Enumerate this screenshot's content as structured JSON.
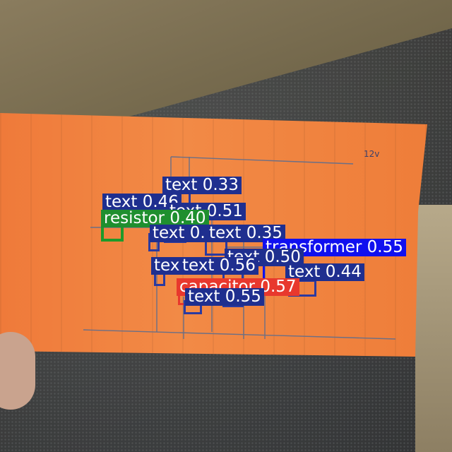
{
  "detections": [
    {
      "label": "text 0.33",
      "cls": "text"
    },
    {
      "label": "text 0.51",
      "cls": "text"
    },
    {
      "label": "text 0.46",
      "cls": "text"
    },
    {
      "label": "resistor 0.40",
      "cls": "resistor"
    },
    {
      "label": "text 0.35",
      "cls": "text"
    },
    {
      "label": "text 0.56",
      "cls": "text"
    },
    {
      "label": "text 0.56",
      "cls": "text"
    },
    {
      "label": "text 0.50",
      "cls": "text"
    },
    {
      "label": "transformer 0.55",
      "cls": "transformer"
    },
    {
      "label": "text 0.44",
      "cls": "text"
    },
    {
      "label": "capacitor 0.57",
      "cls": "capacitor"
    },
    {
      "label": "text 0.55",
      "cls": "text"
    }
  ],
  "colors": {
    "text": "#1f2f8f",
    "resistor": "#1f8f2f",
    "capacitor": "#e8382d",
    "transformer": "#1010ef",
    "paper": "#f28a46"
  },
  "handwriting": "12v"
}
